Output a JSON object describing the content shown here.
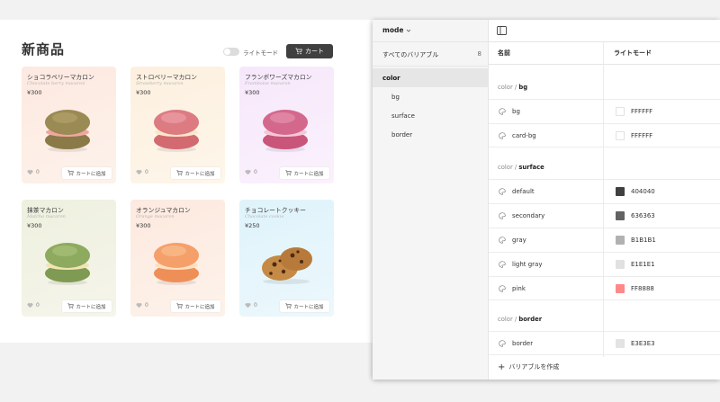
{
  "shop": {
    "title": "新商品",
    "theme_toggle_label": "ライトモード",
    "theme_toggle_on": false,
    "cart_label": "カート",
    "products": [
      {
        "name": "ショコラベリーマカロン",
        "subtitle": "Chocolate berry macaron",
        "price": "¥300",
        "likes": "0",
        "add_label": "カートに追加",
        "bg": "#fdeee6",
        "image": "macaron-chocolate-berry"
      },
      {
        "name": "ストロベリーマカロン",
        "subtitle": "Strawberry macaron",
        "price": "¥300",
        "likes": "0",
        "add_label": "カートに追加",
        "bg": "#fdf2e2",
        "image": "macaron-strawberry"
      },
      {
        "name": "フランボワーズマカロン",
        "subtitle": "Framboise macaron",
        "price": "¥300",
        "likes": "0",
        "add_label": "カートに追加",
        "bg": "#f9ecfb",
        "image": "macaron-framboise"
      },
      {
        "name": "抹茶マカロン",
        "subtitle": "Matcha macaron",
        "price": "¥300",
        "likes": "0",
        "add_label": "カートに追加",
        "bg": "#f1f2e4",
        "image": "macaron-matcha"
      },
      {
        "name": "オランジュマカロン",
        "subtitle": "Orange macaron",
        "price": "¥300",
        "likes": "0",
        "add_label": "カートに追加",
        "bg": "#fdeee4",
        "image": "macaron-orange"
      },
      {
        "name": "チョコレートクッキー",
        "subtitle": "Chocolate cookie",
        "price": "¥250",
        "likes": "0",
        "add_label": "カートに追加",
        "bg": "#e5f6fc",
        "image": "chocolate-chip-cookie"
      }
    ]
  },
  "panel": {
    "mode_label": "mode",
    "all_variables_label": "すべてのバリアブル",
    "all_variables_count": "8",
    "groups": [
      "color",
      "bg",
      "surface",
      "border"
    ],
    "active_group": "color",
    "columns": {
      "name": "名前",
      "mode": "ライトモード"
    },
    "sections": [
      {
        "prefix": "color / ",
        "name": "bg",
        "variables": [
          {
            "name": "bg",
            "value": "FFFFFF",
            "color": "#FFFFFF"
          },
          {
            "name": "card-bg",
            "value": "FFFFFF",
            "color": "#FFFFFF"
          }
        ]
      },
      {
        "prefix": "color / ",
        "name": "surface",
        "variables": [
          {
            "name": "default",
            "value": "404040",
            "color": "#404040"
          },
          {
            "name": "secondary",
            "value": "636363",
            "color": "#636363"
          },
          {
            "name": "gray",
            "value": "B1B1B1",
            "color": "#B1B1B1"
          },
          {
            "name": "light gray",
            "value": "E1E1E1",
            "color": "#E1E1E1"
          },
          {
            "name": "pink",
            "value": "FF8888",
            "color": "#FF8888"
          }
        ]
      },
      {
        "prefix": "color / ",
        "name": "border",
        "variables": [
          {
            "name": "border",
            "value": "E3E3E3",
            "color": "#E3E3E3"
          }
        ]
      }
    ],
    "create_label": "バリアブルを作成"
  }
}
